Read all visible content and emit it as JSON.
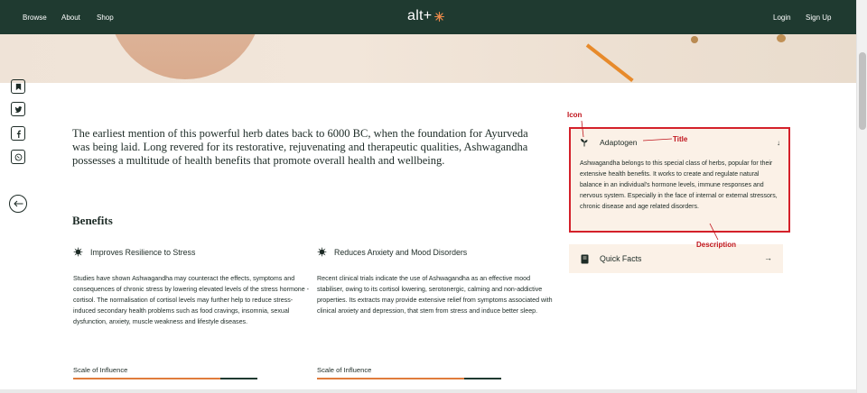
{
  "nav": {
    "browse": "Browse",
    "about": "About",
    "shop": "Shop",
    "logo": "alt+",
    "login": "Login",
    "signup": "Sign Up",
    "bg_color": "#1f3a30",
    "accent": "#e07c3c"
  },
  "share_icons": [
    "bookmark-icon",
    "twitter-icon",
    "facebook-icon",
    "whatsapp-icon",
    "back-arrow-icon"
  ],
  "intro": {
    "text": "The earliest mention of this powerful herb dates back to 6000 BC, when the foundation for Ayurveda was being laid. Long revered for its restorative, rejuvenating and therapeutic qualities, Ashwagandha possesses a multitude of health benefits that promote overall health and wellbeing."
  },
  "benefits": {
    "title": "Benefits",
    "items": [
      {
        "heading": "Improves Resilience to Stress",
        "body": "Studies have shown Ashwagandha may counteract the effects, symptoms and consequences of chronic stress by lowering elevated levels of the stress hormone - cortisol. The normalisation of cortisol levels may further help to reduce stress-induced secondary health problems such as food cravings, insomnia, sexual dysfunction, anxiety, muscle weakness and lifestyle diseases.",
        "scale_label": "Scale of Influence",
        "scale_value": 0.8
      },
      {
        "heading": "Reduces Anxiety and Mood Disorders",
        "body": "Recent clinical trials indicate the use of Ashwagandha as an effective mood stabiliser, owing to its cortisol lowering, serotonergic, calming and non-addictive properties. Its extracts may provide extensive relief from symptoms associated with clinical anxiety and depression, that stem from stress and induce better sleep.",
        "scale_label": "Scale of Influence",
        "scale_value": 0.8
      }
    ]
  },
  "card": {
    "title": "Adaptogen",
    "toggle_icon": "arrow-down-icon",
    "description": "Ashwagandha belongs to this special class of herbs, popular for their extensive health benefits. It works to create and regulate natural balance in an individual's hormone levels, immune responses and nervous system. Especially in the face of internal or external stressors, chronic disease and age related disorders.",
    "highlight_color": "#d4202a"
  },
  "quick_facts": {
    "label": "Quick Facts",
    "arrow": "→"
  },
  "annotations": {
    "icon": "Icon",
    "title": "Title",
    "description": "Description",
    "color": "#c0141c"
  }
}
